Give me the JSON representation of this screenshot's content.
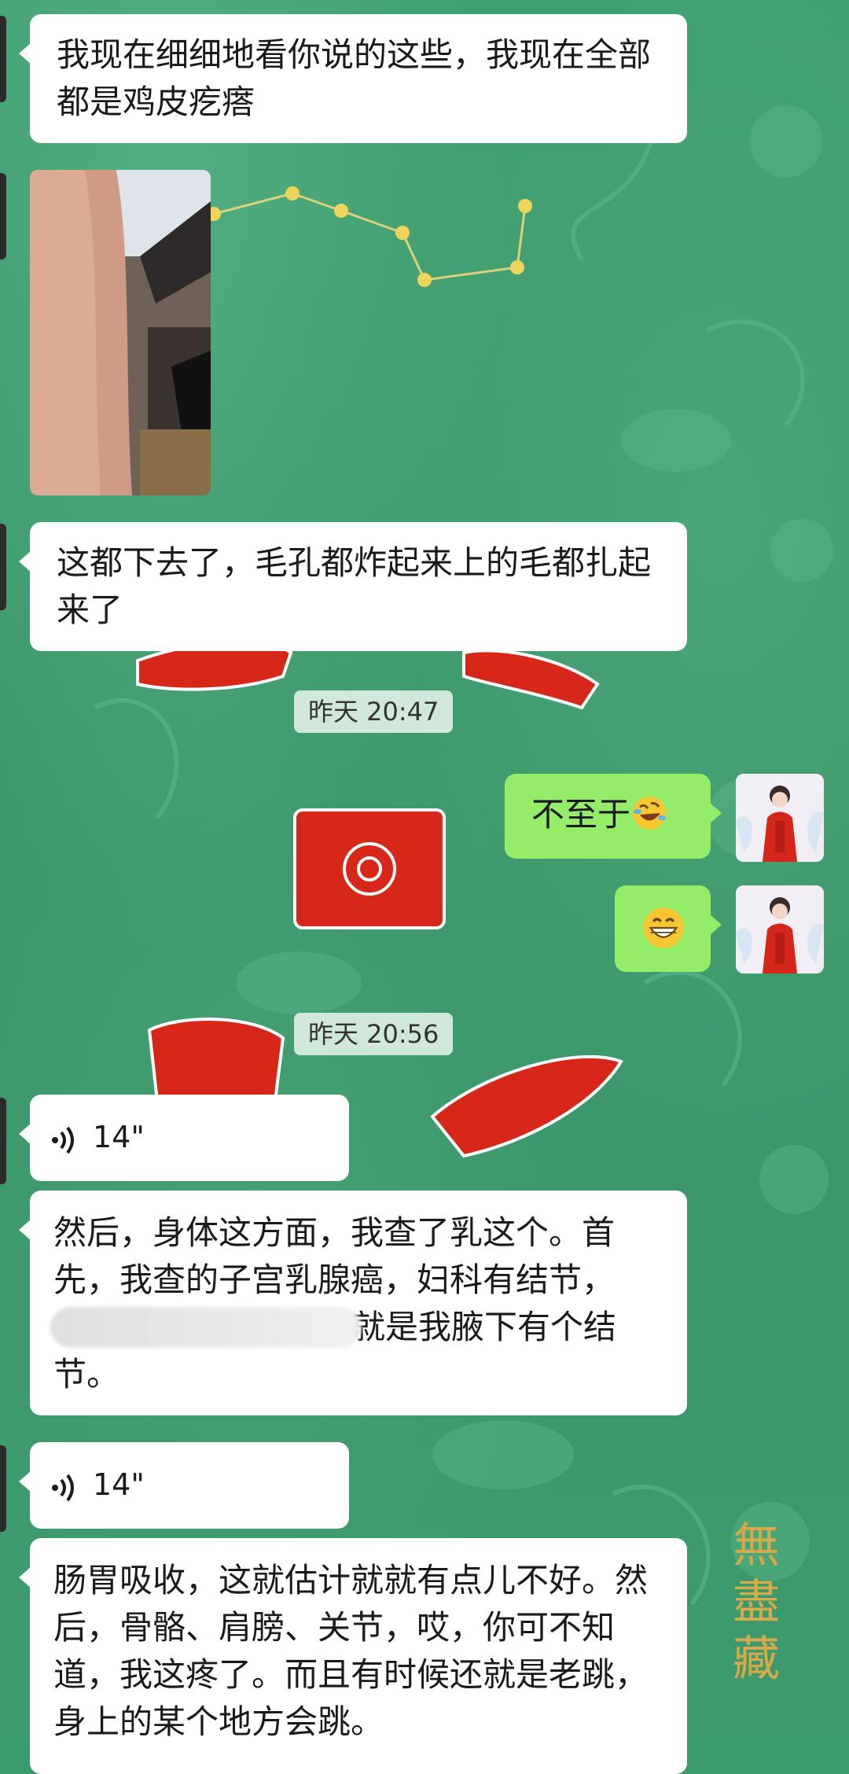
{
  "messages": {
    "m1": {
      "text": "我现在细细地看你说的这些，我现在全部都是鸡皮疙瘩"
    },
    "m2": {
      "text": "这都下去了，毛孔都炸起来上的毛都扎起来了"
    },
    "m3": {
      "text": "不至于",
      "emoji": "rolling-on-floor-laughing-emoji"
    },
    "m4": {
      "emoji": "grinning-face-emoji"
    },
    "voice1": {
      "duration": "14\""
    },
    "m5": {
      "text": "然后，身体这方面，我查了乳这个。首先，我查的子宫乳腺癌，妇科有结节，",
      "text_tail": "就是我腋下有个结节。"
    },
    "voice2": {
      "duration": "14\""
    },
    "m6": {
      "text": "肠胃吸收，这就估计就就有点儿不好。然后，骨骼、肩膀、关节，哎，你可不知道，我这疼了。而且有时候还就是老跳，身上的某个地方会跳。"
    }
  },
  "timestamps": {
    "t1": "昨天 20:47",
    "t2": "昨天 20:56"
  },
  "background": {
    "seal_text": "無盡藏",
    "base_color": "#3a9a6c"
  },
  "colors": {
    "incoming_bubble": "#ffffff",
    "outgoing_bubble": "#95ec69"
  }
}
